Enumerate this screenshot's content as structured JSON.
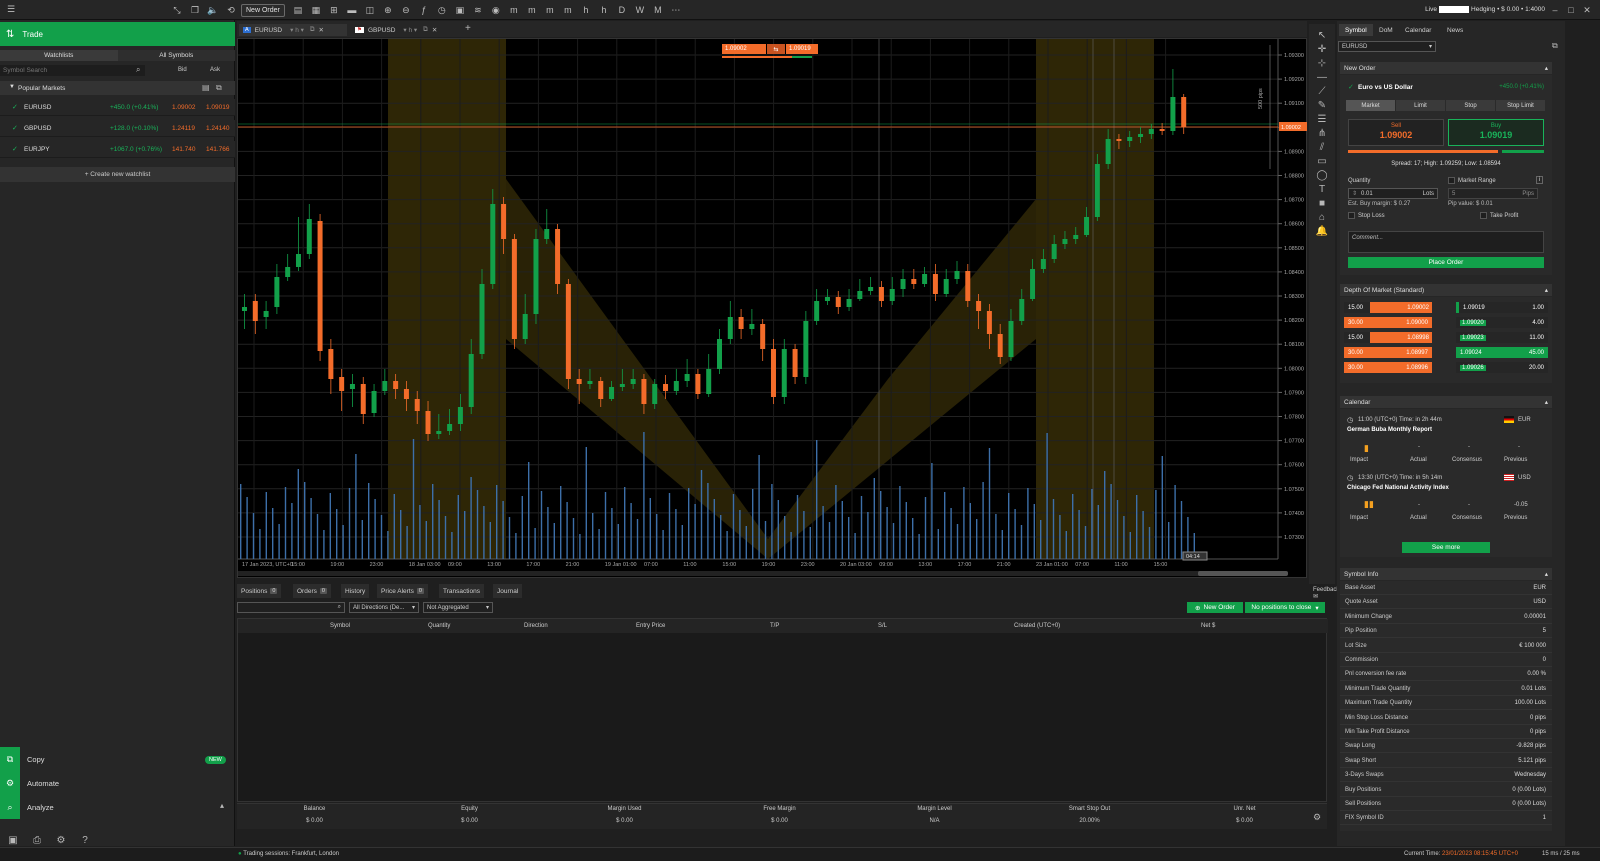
{
  "topbar": {
    "new_order": "New Order",
    "account_prefix": "Live",
    "account_suffix": "Hedging • $ 0.00 • 1:4000"
  },
  "left": {
    "trade": "Trade",
    "tabs": [
      "Watchlists",
      "All Symbols"
    ],
    "search_placeholder": "Symbol Search",
    "col_bid": "Bid",
    "col_ask": "Ask",
    "popular": "Popular Markets",
    "markets": [
      {
        "name": "EURUSD",
        "change": "+450.0 (+0.41%)",
        "bid": "1.09002",
        "ask": "1.09019"
      },
      {
        "name": "GBPUSD",
        "change": "+128.0 (+0.10%)",
        "bid": "1.24119",
        "ask": "1.24140"
      },
      {
        "name": "EURJPY",
        "change": "+1067.0 (+0.76%)",
        "bid": "141.740",
        "ask": "141.766"
      }
    ],
    "create_watchlist": "+ Create new watchlist",
    "nav": [
      {
        "label": "Copy"
      },
      {
        "label": "Automate"
      },
      {
        "label": "Analyze"
      }
    ],
    "new_badge": "NEW"
  },
  "chart": {
    "tabs": [
      {
        "label": "EURUSD"
      },
      {
        "label": "GBPUSD"
      }
    ],
    "sell_tag": "1.09002",
    "buy_tag": "1.09019",
    "range_label": "500 pips",
    "price_labels": [
      "1.09300",
      "1.09200",
      "1.09100",
      "1.09000",
      "1.08900",
      "1.08800",
      "1.08700",
      "1.08600",
      "1.08500",
      "1.08400",
      "1.08300",
      "1.08200",
      "1.08100",
      "1.08000",
      "1.07900",
      "1.07800",
      "1.07700",
      "1.07600",
      "1.07500",
      "1.07400",
      "1.07300"
    ],
    "current_price": "1.09002",
    "time_labels": [
      "17 Jan 2023, UTC+0",
      "15:00",
      "19:00",
      "23:00",
      "18 Jan 03:00",
      "09:00",
      "13:00",
      "17:00",
      "21:00",
      "19 Jan 01:00",
      "07:00",
      "11:00",
      "15:00",
      "19:00",
      "23:00",
      "20 Jan 03:00",
      "09:00",
      "13:00",
      "17:00",
      "21:00",
      "23 Jan 01:00",
      "07:00",
      "11:00",
      "15:00"
    ],
    "cursor_time": "04:14"
  },
  "positions": {
    "tabs": [
      {
        "label": "Positions",
        "count": "0"
      },
      {
        "label": "Orders",
        "count": "0"
      },
      {
        "label": "History"
      },
      {
        "label": "Price Alerts",
        "count": "0"
      },
      {
        "label": "Transactions"
      },
      {
        "label": "Journal"
      }
    ],
    "feedback": "Feedback",
    "directions": "All Directions (De...",
    "aggregation": "Not Aggregated",
    "new_order": "New Order",
    "no_positions": "No positions to close",
    "columns": [
      "Symbol",
      "Quantity",
      "Direction",
      "Entry Price",
      "T/P",
      "S/L",
      "Created (UTC+0)",
      "Net $"
    ],
    "balances": [
      {
        "label": "Balance",
        "value": "$ 0.00"
      },
      {
        "label": "Equity",
        "value": "$ 0.00"
      },
      {
        "label": "Margin Used",
        "value": "$ 0.00"
      },
      {
        "label": "Free Margin",
        "value": "$ 0.00"
      },
      {
        "label": "Margin Level",
        "value": "N/A"
      },
      {
        "label": "Smart Stop Out",
        "value": "20.00%"
      },
      {
        "label": "Unr. Net",
        "value": "$ 0.00"
      }
    ]
  },
  "status": {
    "sessions": "Trading sessions: Frankfurt, London",
    "time_label": "Current Time:",
    "time_value": "23/01/2023 08:15:45",
    "tz": "UTC+0",
    "latency": "15 ms / 25 ms"
  },
  "right": {
    "tabs": [
      "Symbol",
      "DoM",
      "Calendar",
      "News"
    ],
    "symbol": "EURUSD",
    "new_order": "New Order",
    "instrument": "Euro vs US Dollar",
    "instrument_change": "+450.0 (+0.41%)",
    "order_types": [
      "Market",
      "Limit",
      "Stop",
      "Stop Limit"
    ],
    "sell_label": "Sell",
    "sell_price": "1.09002",
    "buy_label": "Buy",
    "buy_price": "1.09019",
    "spread_info": "Spread: 17; High: 1.09259; Low: 1.08594",
    "quantity_label": "Quantity",
    "market_range": "Market Range",
    "quantity_value": "0.01",
    "lots": "Lots",
    "pips_value": "5",
    "pips": "Pips",
    "est_margin": "Est. Buy margin: $ 0.27",
    "pip_value": "Pip value: $ 0.01",
    "stop_loss": "Stop Loss",
    "take_profit": "Take Profit",
    "comment_placeholder": "Comment...",
    "place_order": "Place Order",
    "dom_title": "Depth Of Market (Standard)",
    "dom": [
      {
        "vol_l": "15.00",
        "price_l": "1.09002",
        "price_r": "1.09019",
        "vol_r": "1.00"
      },
      {
        "vol_l": "30.00",
        "price_l": "1.09000",
        "price_r": "1.09020",
        "vol_r": "4.00"
      },
      {
        "vol_l": "15.00",
        "price_l": "1.08998",
        "price_r": "1.09023",
        "vol_r": "11.00"
      },
      {
        "vol_l": "30.00",
        "price_l": "1.08997",
        "price_r": "1.09024",
        "vol_r": "45.00"
      },
      {
        "vol_l": "30.00",
        "price_l": "1.08996",
        "price_r": "1.09026",
        "vol_r": "20.00"
      }
    ],
    "calendar_title": "Calendar",
    "events": [
      {
        "time": "11:00 (UTC+0) Time: in 2h 44m",
        "currency": "EUR",
        "title": "German Buba Monthly Report",
        "actual": "-",
        "consensus": "-",
        "previous": "-"
      },
      {
        "time": "13:30 (UTC+0) Time: in 5h 14m",
        "currency": "USD",
        "title": "Chicago Fed National Activity Index",
        "actual": "-",
        "consensus": "-",
        "previous": "-0.05"
      }
    ],
    "cal_cols": [
      "Impact",
      "Actual",
      "Consensus",
      "Previous"
    ],
    "see_more": "See more",
    "symbol_info_title": "Symbol Info",
    "symbol_info": [
      {
        "k": "Base Asset",
        "v": "EUR"
      },
      {
        "k": "Quote Asset",
        "v": "USD"
      },
      {
        "k": "Minimum Change",
        "v": "0.00001"
      },
      {
        "k": "Pip Position",
        "v": "5"
      },
      {
        "k": "Lot Size",
        "v": "€ 100 000"
      },
      {
        "k": "Commission",
        "v": "0"
      },
      {
        "k": "Pnl conversion fee rate",
        "v": "0.00 %"
      },
      {
        "k": "Minimum Trade Quantity",
        "v": "0.01 Lots"
      },
      {
        "k": "Maximum Trade Quantity",
        "v": "100.00 Lots"
      },
      {
        "k": "Min Stop Loss Distance",
        "v": "0 pips"
      },
      {
        "k": "Min Take Profit Distance",
        "v": "0 pips"
      },
      {
        "k": "Swap Long",
        "v": "-9.828 pips"
      },
      {
        "k": "Swap Short",
        "v": "5.121 pips"
      },
      {
        "k": "3-Days Swaps",
        "v": "Wednesday"
      },
      {
        "k": "Buy Positions",
        "v": "0 (0.00 Lots)"
      },
      {
        "k": "Sell Positions",
        "v": "0 (0.00 Lots)"
      },
      {
        "k": "FIX Symbol ID",
        "v": "1"
      }
    ]
  },
  "colors": {
    "green": "#12a04a",
    "orange": "#f36c2a",
    "highlight": "#3a3008"
  }
}
